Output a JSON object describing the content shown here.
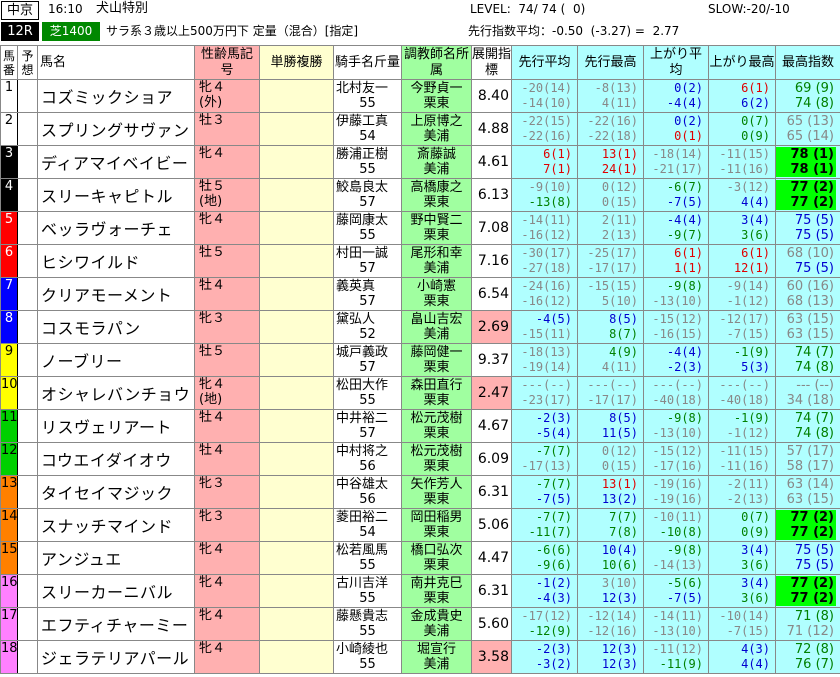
{
  "header": {
    "venue": "中京",
    "time": "16:10",
    "race_name": "犬山特別",
    "race_no": "12R",
    "course": "芝1400",
    "conditions": "サラ系３歳以上500万円下 定量（混合）[指定]",
    "level": "LEVEL:  74/ 74 (  0)",
    "slow": "SLOW:-20/-10",
    "pace_avg": "先行指数平均：-0.50  (-3.27) =  2.77"
  },
  "columns": {
    "no": "馬番",
    "yoso": "予想",
    "name": "馬名",
    "sex": "性齢馬記号",
    "odds": "単勝複勝",
    "jockey": "騎手名斤量",
    "trainer": "調教師名所属",
    "tenkai": "展開指標",
    "senko_avg": "先行平均",
    "senko_max": "先行最高",
    "agari_avg": "上がり平均",
    "agari_max": "上がり最高",
    "best": "最高指数"
  },
  "colors": {
    "frame1": "#ffffff",
    "frame2": "#ffffff",
    "frame3": "#000000",
    "frame4": "#000000",
    "frame5": "#ff0000",
    "frame6": "#ff0000",
    "frame7": "#0000ff",
    "frame8": "#0000ff",
    "frame9": "#ffff00",
    "frame10": "#ffff00",
    "frame11": "#00d000",
    "frame12": "#00d000",
    "frame13": "#ff8000",
    "frame14": "#ff8000",
    "frame15": "#ff8000",
    "frame16": "#ff80ff",
    "frame17": "#ff80ff",
    "frame18": "#ff80ff"
  },
  "horses": [
    {
      "no": "1",
      "name": "コズミックショア",
      "sex": "牝４",
      "mark": "(外)",
      "jockey": "北村友一",
      "kin": "55",
      "trainer": "今野貞一",
      "shozoku": "栗東",
      "shisu": "8.40",
      "sa1": "-20(14)",
      "sa2": "-14(10)",
      "sm1": "-8(13)",
      "sm2": "4(11)",
      "aa1": "0(2)",
      "aa2": "-4(4)",
      "am1": "6(1)",
      "am2": "6(2)",
      "b1": "69 (9)",
      "b2": "74 (8)"
    },
    {
      "no": "2",
      "name": "スプリングサヴァン",
      "sex": "牡３",
      "mark": "",
      "jockey": "伊藤工真",
      "kin": "54",
      "trainer": "上原博之",
      "shozoku": "美浦",
      "shisu": "4.88",
      "sa1": "-22(15)",
      "sa2": "-22(16)",
      "sm1": "-22(16)",
      "sm2": "-22(18)",
      "aa1": "0(2)",
      "aa2": "0(1)",
      "am1": "0(7)",
      "am2": "0(9)",
      "b1": "65 (13)",
      "b2": "65 (14)"
    },
    {
      "no": "3",
      "name": "ディアマイベイビー",
      "sex": "牝４",
      "mark": "",
      "jockey": "勝浦正樹",
      "kin": "55",
      "trainer": "斎藤誠",
      "shozoku": "美浦",
      "shisu": "4.61",
      "sa1": "6(1)",
      "sa2": "7(1)",
      "sm1": "13(1)",
      "sm2": "24(1)",
      "aa1": "-18(14)",
      "aa2": "-21(17)",
      "am1": "-11(15)",
      "am2": "-11(16)",
      "b1": "78 (1)",
      "b2": "78 (1)"
    },
    {
      "no": "4",
      "name": "スリーキャピトル",
      "sex": "牡５",
      "mark": "(地)",
      "jockey": "鮫島良太",
      "kin": "57",
      "trainer": "高橋康之",
      "shozoku": "栗東",
      "shisu": "6.13",
      "sa1": "-9(10)",
      "sa2": "-13(8)",
      "sm1": "0(12)",
      "sm2": "0(15)",
      "aa1": "-6(7)",
      "aa2": "-7(5)",
      "am1": "-3(12)",
      "am2": "4(4)",
      "b1": "77 (2)",
      "b2": "77 (2)"
    },
    {
      "no": "5",
      "name": "ベッラヴォーチェ",
      "sex": "牝４",
      "mark": "",
      "jockey": "藤岡康太",
      "kin": "55",
      "trainer": "野中賢二",
      "shozoku": "栗東",
      "shisu": "7.08",
      "sa1": "-14(11)",
      "sa2": "-16(12)",
      "sm1": "2(11)",
      "sm2": "2(13)",
      "aa1": "-4(4)",
      "aa2": "-9(7)",
      "am1": "3(4)",
      "am2": "3(6)",
      "b1": "75 (5)",
      "b2": "75 (5)"
    },
    {
      "no": "6",
      "name": "ヒシワイルド",
      "sex": "牡５",
      "mark": "",
      "jockey": "村田一誠",
      "kin": "57",
      "trainer": "尾形和幸",
      "shozoku": "美浦",
      "shisu": "7.16",
      "sa1": "-30(17)",
      "sa2": "-27(18)",
      "sm1": "-25(17)",
      "sm2": "-17(17)",
      "aa1": "6(1)",
      "aa2": "1(1)",
      "am1": "6(1)",
      "am2": "12(1)",
      "b1": "68 (10)",
      "b2": "75 (5)"
    },
    {
      "no": "7",
      "name": "クリアモーメント",
      "sex": "牡４",
      "mark": "",
      "jockey": "義英真",
      "kin": "57",
      "trainer": "小崎憲",
      "shozoku": "栗東",
      "shisu": "6.54",
      "sa1": "-24(16)",
      "sa2": "-16(12)",
      "sm1": "-15(15)",
      "sm2": "5(10)",
      "aa1": "-9(8)",
      "aa2": "-13(10)",
      "am1": "-9(14)",
      "am2": "-1(12)",
      "b1": "60 (16)",
      "b2": "68 (13)"
    },
    {
      "no": "8",
      "name": "コスモラパン",
      "sex": "牝３",
      "mark": "",
      "jockey": "黛弘人",
      "kin": "52",
      "trainer": "畠山吉宏",
      "shozoku": "美浦",
      "shisu": "2.69",
      "sa1": "-4(5)",
      "sa2": "-15(11)",
      "sm1": "8(5)",
      "sm2": "8(7)",
      "aa1": "-15(12)",
      "aa2": "-16(15)",
      "am1": "-12(17)",
      "am2": "-7(15)",
      "b1": "63 (15)",
      "b2": "63 (15)"
    },
    {
      "no": "9",
      "name": "ノーブリー",
      "sex": "牡５",
      "mark": "",
      "jockey": "城戸義政",
      "kin": "57",
      "trainer": "藤岡健一",
      "shozoku": "栗東",
      "shisu": "9.37",
      "sa1": "-18(13)",
      "sa2": "-19(14)",
      "sm1": "4(9)",
      "sm2": "4(11)",
      "aa1": "-4(4)",
      "aa2": "-2(3)",
      "am1": "-1(9)",
      "am2": "5(3)",
      "b1": "74 (7)",
      "b2": "74 (8)"
    },
    {
      "no": "10",
      "name": "オシャレバンチョウ",
      "sex": "牝４",
      "mark": "(地)",
      "jockey": "松田大作",
      "kin": "55",
      "trainer": "森田直行",
      "shozoku": "栗東",
      "shisu": "2.47",
      "sa1": "---(--)",
      "sa2": "-23(17)",
      "sm1": "---(--)",
      "sm2": "-17(17)",
      "aa1": "---(--)",
      "aa2": "-40(18)",
      "am1": "---(--)",
      "am2": "-40(18)",
      "b1": "--- (--)",
      "b2": "34 (18)"
    },
    {
      "no": "11",
      "name": "リスヴェリアート",
      "sex": "牡４",
      "mark": "",
      "jockey": "中井裕二",
      "kin": "57",
      "trainer": "松元茂樹",
      "shozoku": "栗東",
      "shisu": "4.67",
      "sa1": "-2(3)",
      "sa2": "-5(4)",
      "sm1": "8(5)",
      "sm2": "11(5)",
      "aa1": "-9(8)",
      "aa2": "-13(10)",
      "am1": "-1(9)",
      "am2": "-1(12)",
      "b1": "74 (7)",
      "b2": "74 (8)"
    },
    {
      "no": "12",
      "name": "コウエイダイオウ",
      "sex": "牡４",
      "mark": "",
      "jockey": "中村将之",
      "kin": "56",
      "trainer": "松元茂樹",
      "shozoku": "栗東",
      "shisu": "6.09",
      "sa1": "-7(7)",
      "sa2": "-17(13)",
      "sm1": "0(12)",
      "sm2": "0(15)",
      "aa1": "-15(12)",
      "aa2": "-17(16)",
      "am1": "-11(15)",
      "am2": "-11(16)",
      "b1": "57 (17)",
      "b2": "58 (17)"
    },
    {
      "no": "13",
      "name": "タイセイマジック",
      "sex": "牝３",
      "mark": "",
      "jockey": "中谷雄太",
      "kin": "56",
      "trainer": "矢作芳人",
      "shozoku": "栗東",
      "shisu": "6.31",
      "sa1": "-7(7)",
      "sa2": "-7(5)",
      "sm1": "13(1)",
      "sm2": "13(2)",
      "aa1": "-19(16)",
      "aa2": "-19(16)",
      "am1": "-2(11)",
      "am2": "-2(13)",
      "b1": "63 (14)",
      "b2": "63 (15)"
    },
    {
      "no": "14",
      "name": "スナッチマインド",
      "sex": "牝３",
      "mark": "",
      "jockey": "菱田裕二",
      "kin": "54",
      "trainer": "岡田稲男",
      "shozoku": "栗東",
      "shisu": "5.06",
      "sa1": "-7(7)",
      "sa2": "-11(7)",
      "sm1": "7(7)",
      "sm2": "7(8)",
      "aa1": "-10(11)",
      "aa2": "-10(8)",
      "am1": "0(7)",
      "am2": "0(9)",
      "b1": "77 (2)",
      "b2": "77 (2)"
    },
    {
      "no": "15",
      "name": "アンジュエ",
      "sex": "牝４",
      "mark": "",
      "jockey": "松若風馬",
      "kin": "55",
      "trainer": "橋口弘次",
      "shozoku": "栗東",
      "shisu": "4.47",
      "sa1": "-6(6)",
      "sa2": "-9(6)",
      "sm1": "10(4)",
      "sm2": "10(6)",
      "aa1": "-9(8)",
      "aa2": "-14(13)",
      "am1": "3(4)",
      "am2": "3(6)",
      "b1": "75 (5)",
      "b2": "75 (5)"
    },
    {
      "no": "16",
      "name": "スリーカーニバル",
      "sex": "牝４",
      "mark": "",
      "jockey": "古川吉洋",
      "kin": "55",
      "trainer": "南井克巳",
      "shozoku": "栗東",
      "shisu": "6.31",
      "sa1": "-1(2)",
      "sa2": "-4(3)",
      "sm1": "3(10)",
      "sm2": "12(3)",
      "aa1": "-5(6)",
      "aa2": "-7(5)",
      "am1": "3(4)",
      "am2": "3(6)",
      "b1": "77 (2)",
      "b2": "77 (2)"
    },
    {
      "no": "17",
      "name": "エフティチャーミー",
      "sex": "牝４",
      "mark": "",
      "jockey": "藤懸貴志",
      "kin": "55",
      "trainer": "金成貴史",
      "shozoku": "美浦",
      "shisu": "5.60",
      "sa1": "-17(12)",
      "sa2": "-12(9)",
      "sm1": "-12(14)",
      "sm2": "-12(16)",
      "aa1": "-14(11)",
      "aa2": "-13(10)",
      "am1": "-10(14)",
      "am2": "-7(15)",
      "b1": "71 (8)",
      "b2": "71 (12)"
    },
    {
      "no": "18",
      "name": "ジェラテリアパール",
      "sex": "牝４",
      "mark": "",
      "jockey": "小崎綾也",
      "kin": "55",
      "trainer": "堀宣行",
      "shozoku": "美浦",
      "shisu": "3.58",
      "sa1": "-2(3)",
      "sa2": "-3(2)",
      "sm1": "12(3)",
      "sm2": "12(3)",
      "aa1": "-11(12)",
      "aa2": "-11(9)",
      "am1": "4(3)",
      "am2": "4(4)",
      "b1": "72 (8)",
      "b2": "76 (7)"
    }
  ]
}
